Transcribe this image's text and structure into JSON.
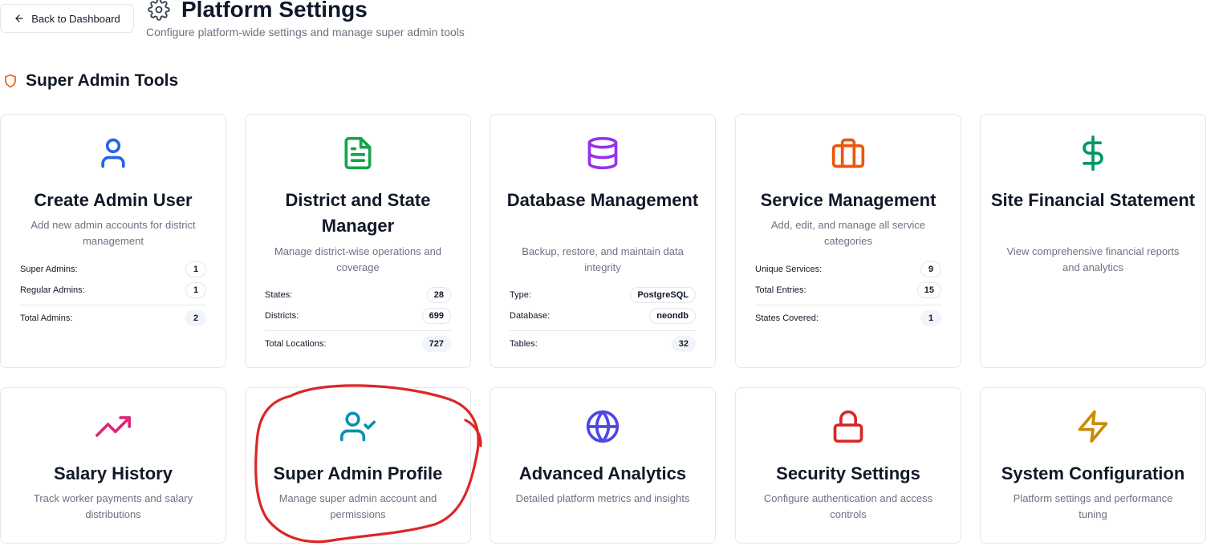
{
  "header": {
    "back_label": "Back to Dashboard",
    "title": "Platform Settings",
    "subtitle": "Configure platform-wide settings and manage super admin tools"
  },
  "section": {
    "title": "Super Admin Tools"
  },
  "colors": {
    "section_icon": "#ea580c",
    "create_admin": "#2563eb",
    "district": "#16a34a",
    "database": "#9333ea",
    "service": "#ea580c",
    "financial": "#059669",
    "salary": "#db2777",
    "profile": "#0891b2",
    "analytics": "#4f46e5",
    "security": "#dc2626",
    "config": "#ca8a04",
    "annotation": "#dc2626"
  },
  "cards": {
    "create_admin": {
      "icon": "user-icon",
      "title": "Create Admin User",
      "desc": "Add new admin accounts for district management",
      "stats": [
        {
          "label": "Super Admins:",
          "value": "1"
        },
        {
          "label": "Regular Admins:",
          "value": "1"
        },
        {
          "label": "Total Admins:",
          "value": "2"
        }
      ]
    },
    "district": {
      "icon": "file-text-icon",
      "title": "District and State Manager",
      "desc": "Manage district-wise operations and coverage",
      "stats": [
        {
          "label": "States:",
          "value": "28"
        },
        {
          "label": "Districts:",
          "value": "699"
        },
        {
          "label": "Total Locations:",
          "value": "727"
        }
      ]
    },
    "database": {
      "icon": "database-icon",
      "title": "Database Management",
      "desc": "Backup, restore, and maintain data integrity",
      "stats": [
        {
          "label": "Type:",
          "value": "PostgreSQL"
        },
        {
          "label": "Database:",
          "value": "neondb"
        },
        {
          "label": "Tables:",
          "value": "32"
        }
      ]
    },
    "service": {
      "icon": "briefcase-icon",
      "title": "Service Management",
      "desc": "Add, edit, and manage all service categories",
      "stats": [
        {
          "label": "Unique Services:",
          "value": "9"
        },
        {
          "label": "Total Entries:",
          "value": "15"
        },
        {
          "label": "States Covered:",
          "value": "1"
        }
      ]
    },
    "financial": {
      "icon": "dollar-sign-icon",
      "title": "Site Financial Statement",
      "desc": "View comprehensive financial reports and analytics"
    },
    "salary": {
      "icon": "trending-up-icon",
      "title": "Salary History",
      "desc": "Track worker payments and salary distributions"
    },
    "profile": {
      "icon": "user-check-icon",
      "title": "Super Admin Profile",
      "desc": "Manage super admin account and permissions"
    },
    "analytics": {
      "icon": "globe-icon",
      "title": "Advanced Analytics",
      "desc": "Detailed platform metrics and insights"
    },
    "security": {
      "icon": "lock-icon",
      "title": "Security Settings",
      "desc": "Configure authentication and access controls"
    },
    "config": {
      "icon": "zap-icon",
      "title": "System Configuration",
      "desc": "Platform settings and performance tuning"
    }
  }
}
